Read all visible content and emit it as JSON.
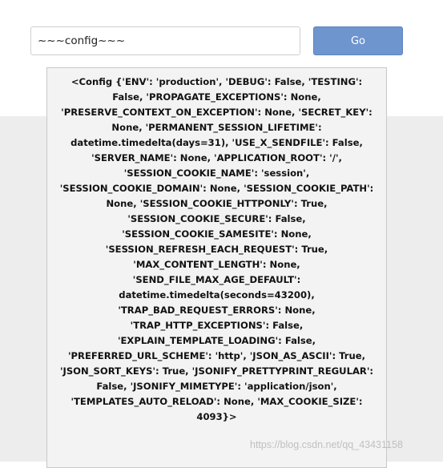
{
  "search": {
    "value": "~~~config~~~",
    "button_label": "Go"
  },
  "result": {
    "text": "<Config {'ENV': 'production', 'DEBUG': False, 'TESTING': False, 'PROPAGATE_EXCEPTIONS': None, 'PRESERVE_CONTEXT_ON_EXCEPTION': None, 'SECRET_KEY': None, 'PERMANENT_SESSION_LIFETIME': datetime.timedelta(days=31), 'USE_X_SENDFILE': False, 'SERVER_NAME': None, 'APPLICATION_ROOT': '/', 'SESSION_COOKIE_NAME': 'session', 'SESSION_COOKIE_DOMAIN': None, 'SESSION_COOKIE_PATH': None, 'SESSION_COOKIE_HTTPONLY': True, 'SESSION_COOKIE_SECURE': False, 'SESSION_COOKIE_SAMESITE': None, 'SESSION_REFRESH_EACH_REQUEST': True, 'MAX_CONTENT_LENGTH': None, 'SEND_FILE_MAX_AGE_DEFAULT': datetime.timedelta(seconds=43200), 'TRAP_BAD_REQUEST_ERRORS': None, 'TRAP_HTTP_EXCEPTIONS': False, 'EXPLAIN_TEMPLATE_LOADING': False, 'PREFERRED_URL_SCHEME': 'http', 'JSON_AS_ASCII': True, 'JSON_SORT_KEYS': True, 'JSONIFY_PRETTYPRINT_REGULAR': False, 'JSONIFY_MIMETYPE': 'application/json', 'TEMPLATES_AUTO_RELOAD': None, 'MAX_COOKIE_SIZE': 4093}>"
  },
  "watermark": {
    "text": "https://blog.csdn.net/qq_43431158"
  }
}
